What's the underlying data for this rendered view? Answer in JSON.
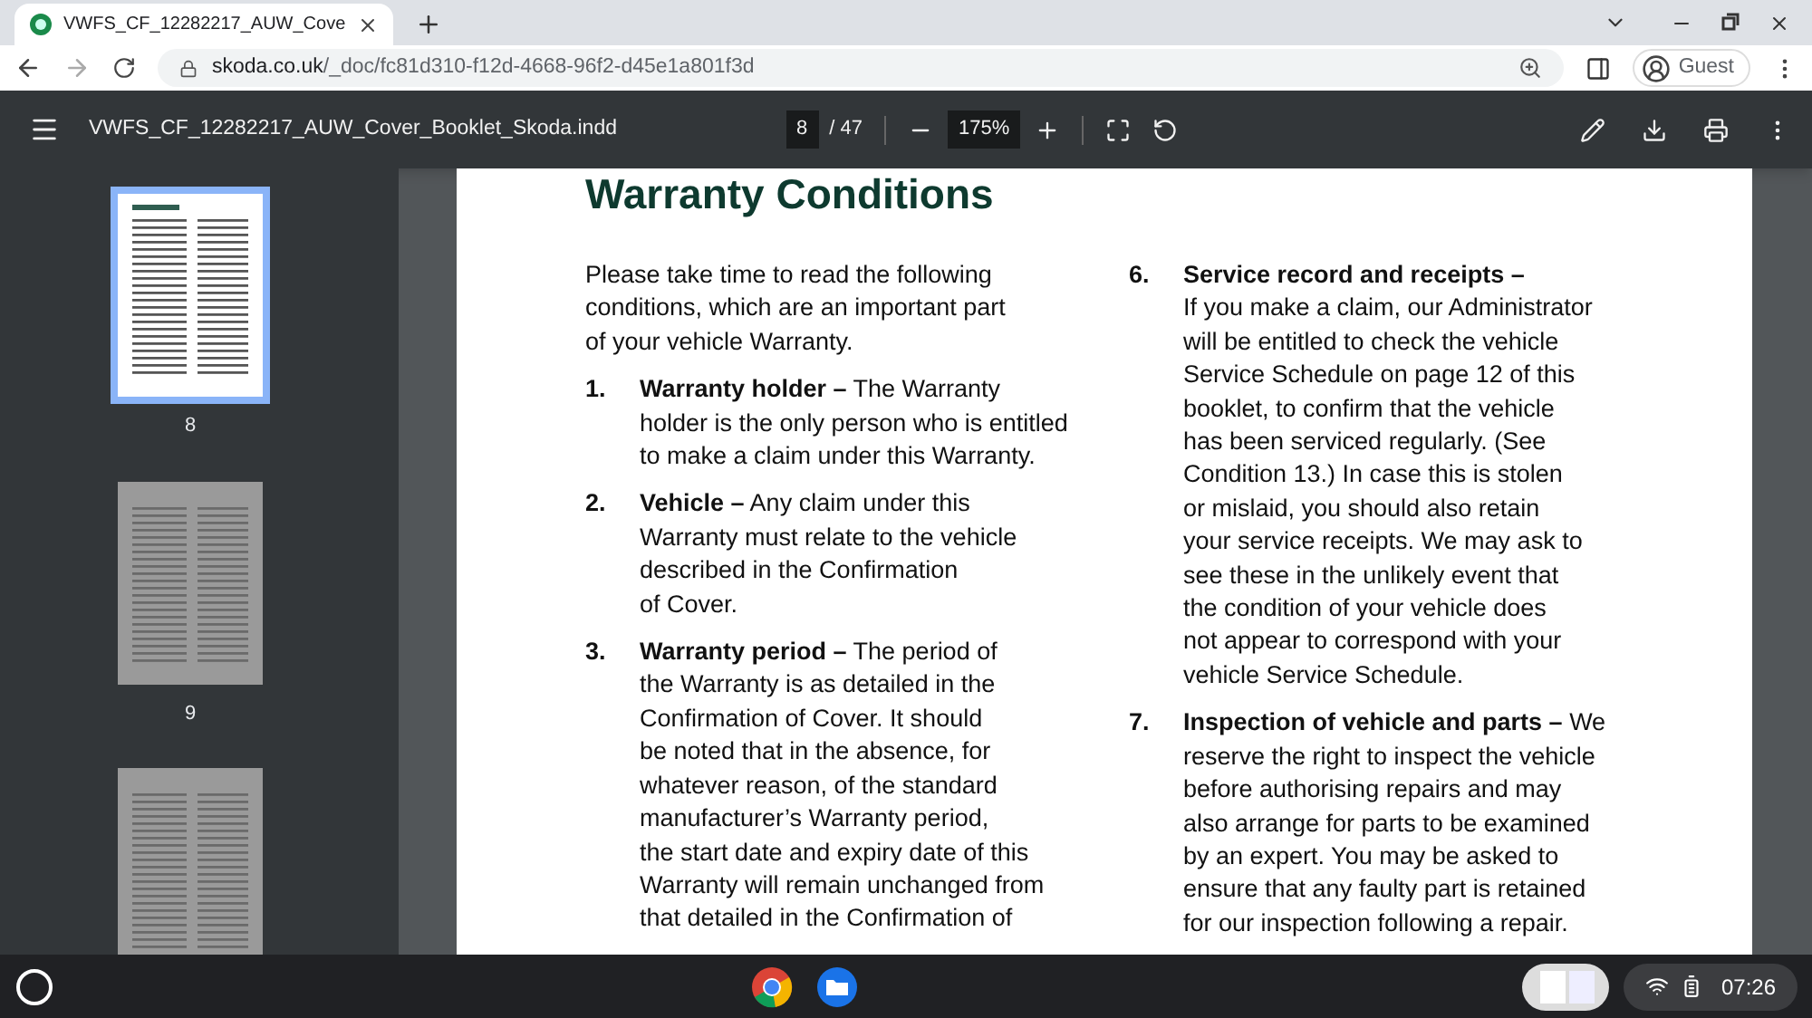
{
  "browser": {
    "tab": {
      "title": "VWFS_CF_12282217_AUW_Cove",
      "selected": true
    },
    "address": {
      "domain": "skoda.co.uk",
      "path": "/_doc/fc81d310-f12d-4668-96f2-d45e1a801f3d"
    },
    "profile": "Guest"
  },
  "pdf_toolbar": {
    "title": "VWFS_CF_12282217_AUW_Cover_Booklet_Skoda.indd",
    "page": "8",
    "page_total": "/ 47",
    "zoom": "175%"
  },
  "thumbnails": [
    {
      "label": "8",
      "selected": true
    },
    {
      "label": "9",
      "selected": false
    },
    {
      "selected": false
    }
  ],
  "document": {
    "heading": "Warranty Conditions",
    "columns": [
      [
        {
          "lines": [
            "Please take time to read the following",
            "conditions, which are an important part",
            "of your vehicle Warranty."
          ]
        },
        {
          "number": "1.",
          "lines": [
            "**Warranty holder –** The Warranty",
            "holder is the only person who is entitled",
            "to make a claim under this Warranty."
          ]
        },
        {
          "number": "2.",
          "lines": [
            "**Vehicle –** Any claim under this",
            "Warranty must relate to the vehicle",
            "described in the Confirmation",
            "of Cover."
          ]
        },
        {
          "number": "3.",
          "lines": [
            "**Warranty period –** The period of",
            "the Warranty is as detailed in the",
            "Confirmation of Cover. It should",
            "be noted that in the absence, for",
            "whatever reason, of the standard",
            "manufacturer’s Warranty period,",
            "the start date and expiry date of this",
            "Warranty will remain unchanged from",
            "that detailed in the Confirmation of"
          ]
        }
      ],
      [
        {
          "number": "6.",
          "lines": [
            "**Service record and receipts –**",
            "If you make a claim, our Administrator",
            "will be entitled to check the vehicle",
            "Service Schedule on page 12 of this",
            "booklet, to confirm that the vehicle",
            "has been serviced regularly. (See",
            "Condition 13.) In case this is stolen",
            "or mislaid, you should also retain",
            "your service receipts. We may ask to",
            "see these in the unlikely event that",
            "the condition of your vehicle does",
            "not appear to correspond with your",
            "vehicle Service Schedule."
          ]
        },
        {
          "number": "7.",
          "lines": [
            "**Inspection of vehicle and parts –** We",
            "reserve the right to inspect the vehicle",
            "before authorising repairs and may",
            "also arrange for parts to be examined",
            "by an expert. You may be asked to",
            "ensure that any faulty part is retained",
            "for our inspection following a repair."
          ]
        }
      ]
    ]
  },
  "taskbar": {
    "time": "07:26"
  }
}
